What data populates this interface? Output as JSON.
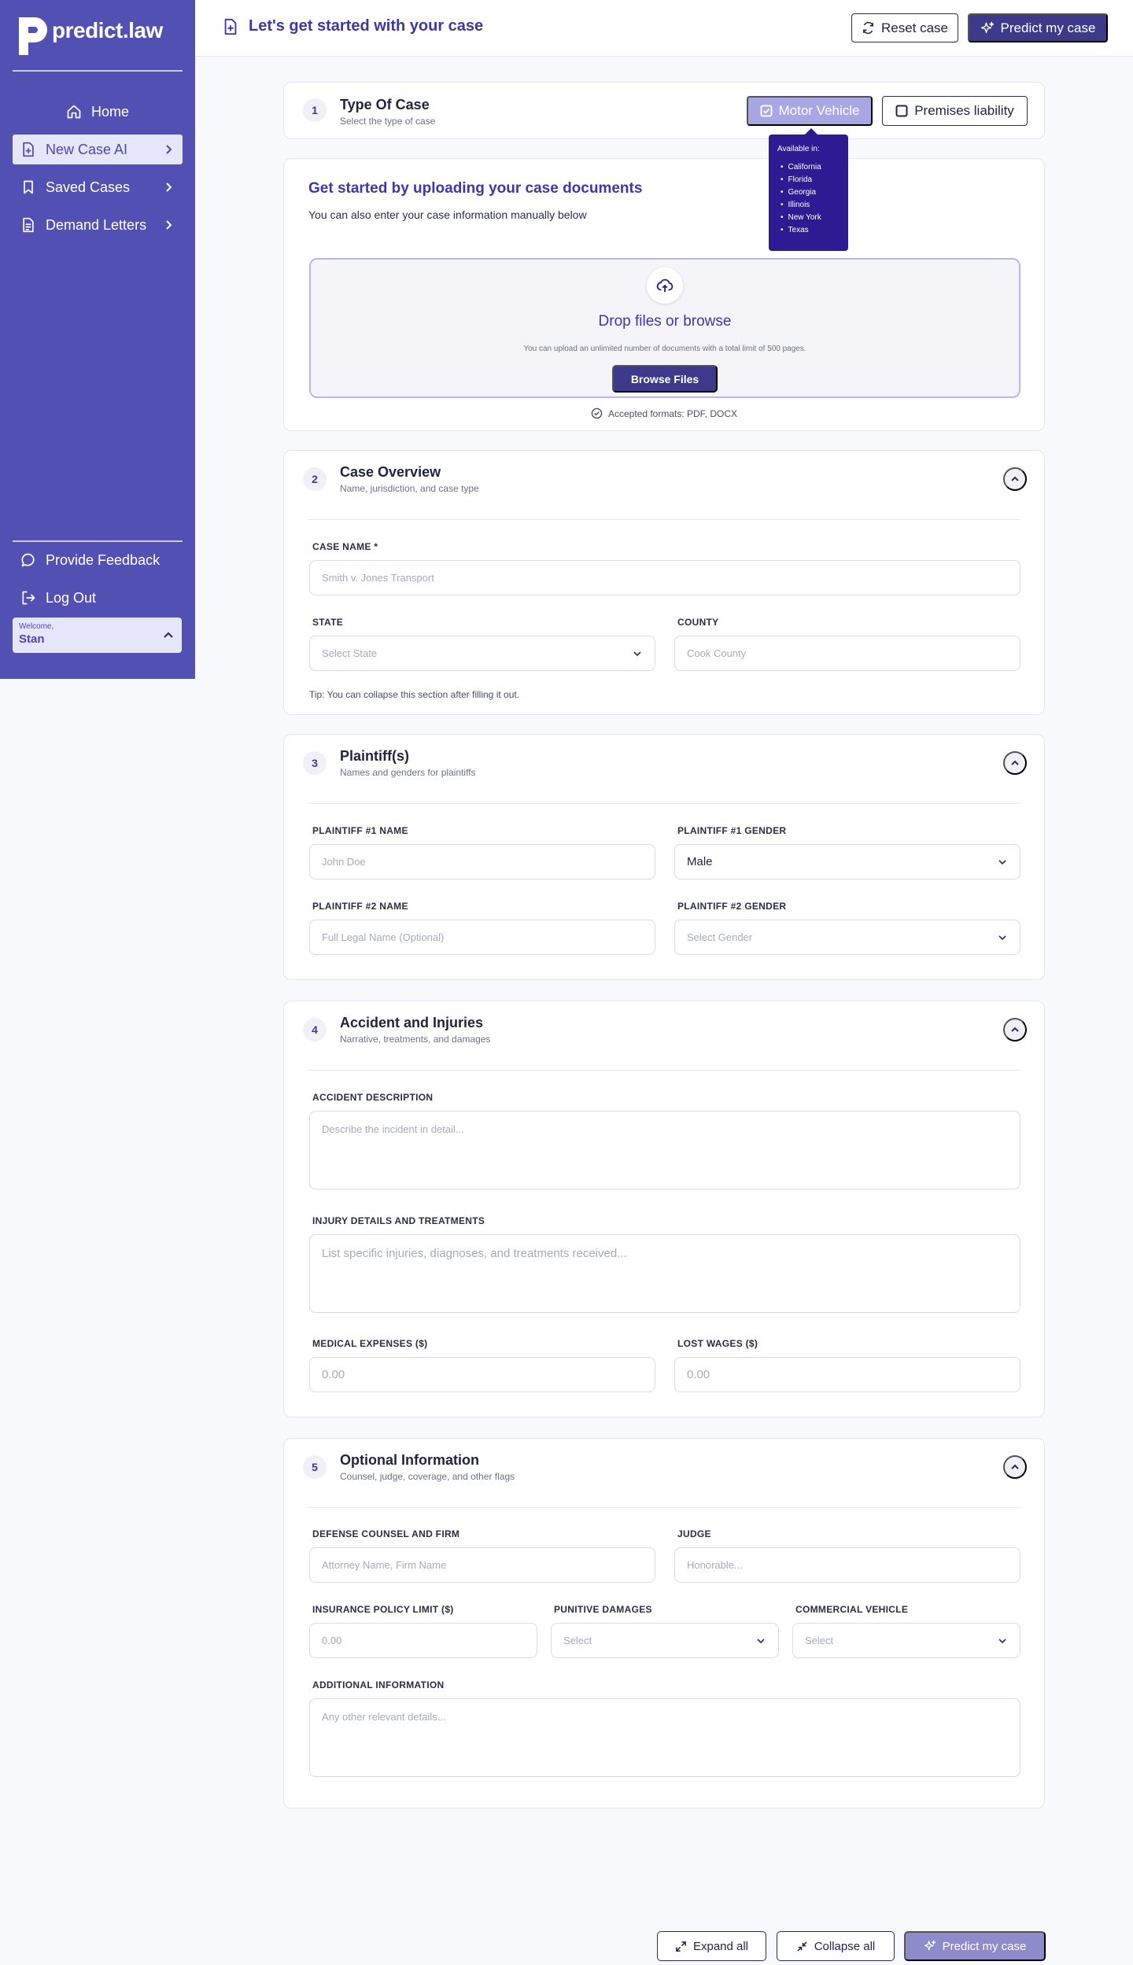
{
  "brand": {
    "name": "predict.law"
  },
  "sidebar": {
    "items": [
      {
        "label": "Home",
        "icon": "home-icon"
      },
      {
        "label": "New Case AI",
        "icon": "file-plus-icon",
        "active": true
      },
      {
        "label": "Saved Cases",
        "icon": "bookmark-icon"
      },
      {
        "label": "Demand Letters",
        "icon": "document-icon"
      }
    ],
    "feedback_label": "Provide Feedback",
    "logout_label": "Log Out",
    "welcome_label": "Welcome,",
    "user_name": "Stan"
  },
  "header": {
    "title": "Let's get started with your case",
    "reset_label": "Reset case",
    "predict_label": "Predict my case"
  },
  "type_of_case": {
    "step": "1",
    "title": "Type Of Case",
    "subtitle": "Select the type of case",
    "options": [
      "Motor Vehicle",
      "Premises liability"
    ],
    "tooltip_title": "Available in:",
    "states": [
      "California",
      "Florida",
      "Georgia",
      "Illinois",
      "New York",
      "Texas"
    ]
  },
  "upload": {
    "title": "Get started by uploading your case documents",
    "subtitle": "You can also enter your case information manually below",
    "drop_title": "Drop files or browse",
    "drop_sub": "You can upload an unlimited number of documents with a total limit of 500 pages.",
    "browse_label": "Browse Files",
    "accepted": "Accepted formats: PDF, DOCX"
  },
  "overview": {
    "step": "2",
    "title": "Case Overview",
    "subtitle": "Name, jurisdiction, and case type",
    "case_name_label": "CASE NAME *",
    "case_name_placeholder": "Smith v. Jones Transport",
    "state_label": "STATE",
    "state_placeholder": "Select State",
    "county_label": "COUNTY",
    "county_placeholder": "Cook County",
    "tip": "Tip: You can collapse this section after filling it out."
  },
  "plaintiffs": {
    "step": "3",
    "title": "Plaintiff(s)",
    "subtitle": "Names and genders for plaintiffs",
    "p1_name_label": "PLAINTIFF #1 NAME",
    "p1_name_placeholder": "John Doe",
    "p1_gender_label": "PLAINTIFF #1 GENDER",
    "p1_gender_value": "Male",
    "p2_name_label": "PLAINTIFF #2 NAME",
    "p2_name_placeholder": "Full Legal Name (Optional)",
    "p2_gender_label": "PLAINTIFF #2 GENDER",
    "p2_gender_placeholder": "Select Gender"
  },
  "accident": {
    "step": "4",
    "title": "Accident and Injuries",
    "subtitle": "Narrative, treatments, and damages",
    "desc_label": "ACCIDENT DESCRIPTION",
    "desc_placeholder": "Describe the incident in detail...",
    "injury_label": "INJURY DETAILS AND TREATMENTS",
    "injury_placeholder": "List specific injuries, diagnoses, and treatments received...",
    "medical_label": "MEDICAL EXPENSES ($)",
    "medical_placeholder": "0.00",
    "wages_label": "LOST WAGES ($)",
    "wages_placeholder": "0.00"
  },
  "optional": {
    "step": "5",
    "title": "Optional Information",
    "subtitle": "Counsel, judge, coverage, and other flags",
    "counsel_label": "DEFENSE COUNSEL AND FIRM",
    "counsel_placeholder": "Attorney Name, Firm Name",
    "judge_label": "JUDGE",
    "judge_placeholder": "Honorable...",
    "policy_label": "INSURANCE POLICY LIMIT ($)",
    "policy_placeholder": "0.00",
    "punitive_label": "PUNITIVE DAMAGES",
    "punitive_placeholder": "Select",
    "commercial_label": "COMMERCIAL VEHICLE",
    "commercial_placeholder": "Select",
    "additional_label": "ADDITIONAL INFORMATION",
    "additional_placeholder": "Any other relevant details..."
  },
  "footer": {
    "expand_label": "Expand all",
    "collapse_label": "Collapse all",
    "predict_label": "Predict my case"
  },
  "colors": {
    "sidebar": "#5350b4",
    "accent": "#3c38a8",
    "primary_button": "#3d3a8c",
    "tooltip": "#2e1b94"
  }
}
